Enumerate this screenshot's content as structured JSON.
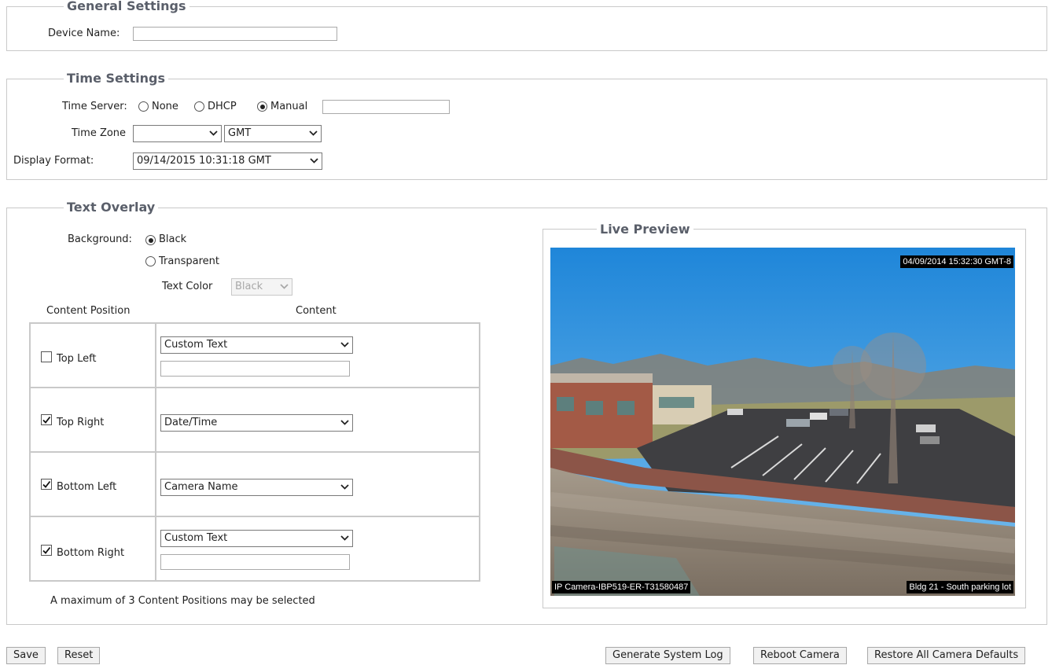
{
  "general": {
    "legend": "General Settings",
    "device_name_label": "Device Name:",
    "device_name_value": ""
  },
  "time": {
    "legend": "Time Settings",
    "server_label": "Time Server:",
    "server_options": [
      "None",
      "DHCP",
      "Manual"
    ],
    "server_selected": "Manual",
    "manual_value": "",
    "zone_label": "Time Zone",
    "zone_value": "",
    "zone_gmt": "GMT",
    "format_label": "Display Format:",
    "format_value": "09/14/2015 10:31:18 GMT"
  },
  "overlay": {
    "legend": "Text Overlay",
    "background_label": "Background:",
    "background_options": [
      "Black",
      "Transparent"
    ],
    "background_selected": "Black",
    "text_color_label": "Text Color",
    "text_color_value": "Black",
    "col_position": "Content Position",
    "col_content": "Content",
    "rows": [
      {
        "position": "Top Left",
        "checked": false,
        "content": "Custom Text",
        "custom_value": ""
      },
      {
        "position": "Top Right",
        "checked": true,
        "content": "Date/Time"
      },
      {
        "position": "Bottom Left",
        "checked": true,
        "content": "Camera Name"
      },
      {
        "position": "Bottom Right",
        "checked": true,
        "content": "Custom Text",
        "custom_value": ""
      }
    ],
    "note": "A maximum of 3 Content Positions may be selected"
  },
  "preview": {
    "legend": "Live Preview",
    "timestamp": "04/09/2014 15:32:30 GMT-8",
    "camera_name": "IP Camera-IBP519-ER-T31580487",
    "custom_text": "Bldg 21 - South parking lot"
  },
  "buttons": {
    "save": "Save",
    "reset": "Reset",
    "generate_log": "Generate System Log",
    "reboot": "Reboot Camera",
    "restore": "Restore All Camera Defaults"
  }
}
